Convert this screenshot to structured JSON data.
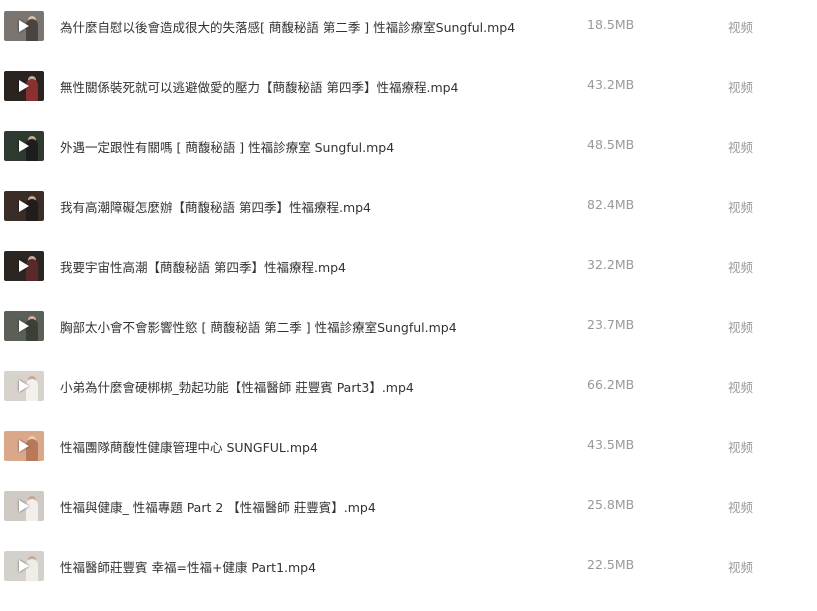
{
  "files": [
    {
      "name": "為什麼自慰以後會造成很大的失落感[ 蔄馥秘語 第二季 ] 性福診療室Sungful.mp4",
      "size": "18.5MB",
      "type": "视频",
      "thumb_icon": "video-thumbnail-icon",
      "thumb_color": "#7a7570"
    },
    {
      "name": "無性關係裝死就可以逃避做愛的壓力【蔄馥秘語 第四季】性福療程.mp4",
      "size": "43.2MB",
      "type": "视频",
      "thumb_icon": "video-thumbnail-icon",
      "thumb_color": "#2a2420"
    },
    {
      "name": "外遇一定跟性有關嗎 [ 蔄馥秘語 ] 性福診療室 Sungful.mp4",
      "size": "48.5MB",
      "type": "视频",
      "thumb_icon": "video-thumbnail-icon",
      "thumb_color": "#2f3a30"
    },
    {
      "name": "我有高潮障礙怎麼辦【蔄馥秘語 第四季】性福療程.mp4",
      "size": "82.4MB",
      "type": "视频",
      "thumb_icon": "video-thumbnail-icon",
      "thumb_color": "#3a2c26"
    },
    {
      "name": "我要宇宙性高潮【蔄馥秘語 第四季】性福療程.mp4",
      "size": "32.2MB",
      "type": "视频",
      "thumb_icon": "video-thumbnail-icon",
      "thumb_color": "#2c2622"
    },
    {
      "name": "胸部太小會不會影響性慾 [ 蔄馥秘語 第二季 ] 性福診療室Sungful.mp4",
      "size": "23.7MB",
      "type": "视频",
      "thumb_icon": "video-thumbnail-icon",
      "thumb_color": "#5a6058"
    },
    {
      "name": "小弟為什麼會硬梆梆_勃起功能【性福醫師 莊豐賓 Part3】.mp4",
      "size": "66.2MB",
      "type": "视频",
      "thumb_icon": "video-thumbnail-icon",
      "thumb_color": "#d8d2cc"
    },
    {
      "name": "性福團隊蔄馥性健康管理中心 SUNGFUL.mp4",
      "size": "43.5MB",
      "type": "视频",
      "thumb_icon": "video-thumbnail-icon",
      "thumb_color": "#d9a88a"
    },
    {
      "name": "性福與健康_ 性福專題 Part 2 【性福醫師 莊豐賓】.mp4",
      "size": "25.8MB",
      "type": "视频",
      "thumb_icon": "video-thumbnail-icon",
      "thumb_color": "#cfcac4"
    },
    {
      "name": "性福醫師莊豐賓 幸福=性福+健康 Part1.mp4",
      "size": "22.5MB",
      "type": "视频",
      "thumb_icon": "video-thumbnail-icon",
      "thumb_color": "#d4d0cb"
    }
  ]
}
